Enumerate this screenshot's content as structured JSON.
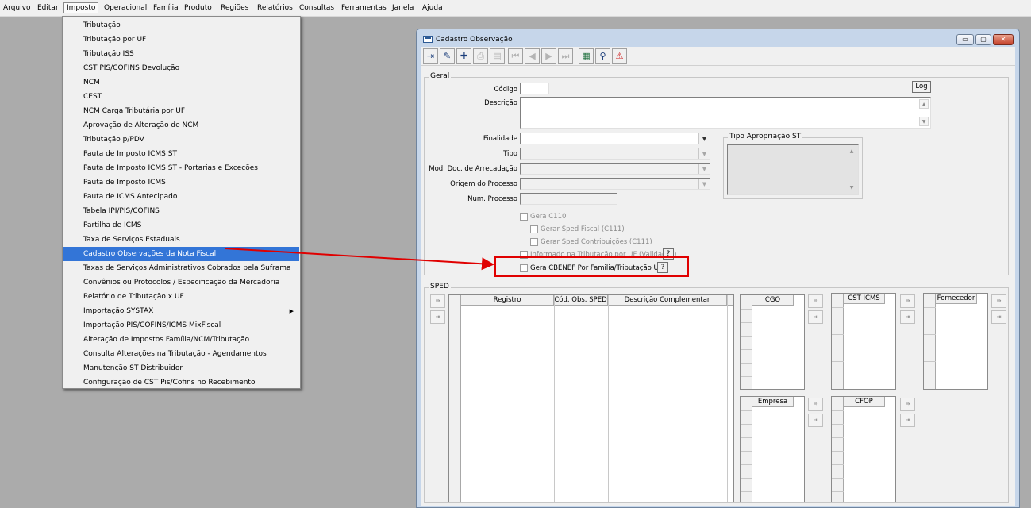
{
  "menubar": {
    "items": [
      "Arquivo",
      "Editar",
      "Imposto",
      "Operacional",
      "Família",
      "Produto",
      "Regiões",
      "Relatórios",
      "Consultas",
      "Ferramentas",
      "Janela",
      "Ajuda"
    ],
    "active": "Imposto"
  },
  "menu": {
    "items": [
      "Tributação",
      "Tributação por UF",
      "Tributação ISS",
      "CST PIS/COFINS Devolução",
      "NCM",
      "CEST",
      "NCM Carga Tributária por UF",
      "Aprovação de Alteração de NCM",
      "Tributação p/PDV",
      "Pauta de Imposto ICMS ST",
      "Pauta de Imposto ICMS ST - Portarias e Exceções",
      "Pauta de Imposto ICMS",
      "Pauta de ICMS Antecipado",
      "Tabela IPI/PIS/COFINS",
      "Partilha de ICMS",
      "Taxa de Serviços Estaduais",
      "Cadastro Observações da Nota Fiscal",
      "Taxas de Serviços Administrativos Cobrados pela Suframa",
      "Convênios ou Protocolos / Especificação da Mercadoria",
      "Relatório de Tributação x UF",
      "Importação SYSTAX",
      "Importação PIS/COFINS/ICMS MixFiscal",
      "Alteração de Impostos Família/NCM/Tributação",
      "Consulta Alterações na Tributação - Agendamentos",
      "Manutenção ST Distribuidor",
      "Configuração de CST Pis/Cofins no Recebimento"
    ],
    "selected_index": 16,
    "submenu_index": 20,
    "highlight_color": "#3375d7"
  },
  "window": {
    "title": "Cadastro Observação",
    "buttons": {
      "minimize": "▭",
      "restore": "▢",
      "close": "✕"
    }
  },
  "toolbar": {
    "icons": [
      "exit-icon",
      "edit-icon",
      "add-icon",
      "save-icon",
      "print-icon",
      "first-icon",
      "prev-icon",
      "next-icon",
      "last-icon",
      "list-icon",
      "search-icon",
      "alert-icon"
    ]
  },
  "geral": {
    "title": "Geral",
    "codigo_label": "Código",
    "codigo_value": "",
    "log_label": "Log",
    "descricao_label": "Descrição",
    "descricao_value": "",
    "finalidade_label": "Finalidade",
    "tipo_label": "Tipo",
    "mod_label": "Mod. Doc. de Arrecadação",
    "origem_label": "Origem do Processo",
    "num_label": "Num. Processo",
    "tipo_apropriacao_label": "Tipo Apropriação ST",
    "gera_c110": "Gera C110",
    "gerar_sped_fiscal": "Gerar Sped Fiscal (C111)",
    "gerar_sped_contrib": "Gerar Sped Contribuições (C111)",
    "informado_tributacao": "Informado na Tributação por UF (Validação)",
    "gera_cbenef": "Gera CBENEF Por Familia/Tributação UF",
    "help_label": "?"
  },
  "sped": {
    "title": "SPED",
    "main_columns": [
      "Registro",
      "Cód. Obs. SPED",
      "Descrição Complementar"
    ],
    "cgo": "CGO",
    "cst_icms": "CST ICMS",
    "fornecedor": "Fornecedor",
    "empresa": "Empresa",
    "cfop": "CFOP"
  },
  "colors": {
    "highlight_border": "#e00000",
    "arrow": "#e00000"
  }
}
